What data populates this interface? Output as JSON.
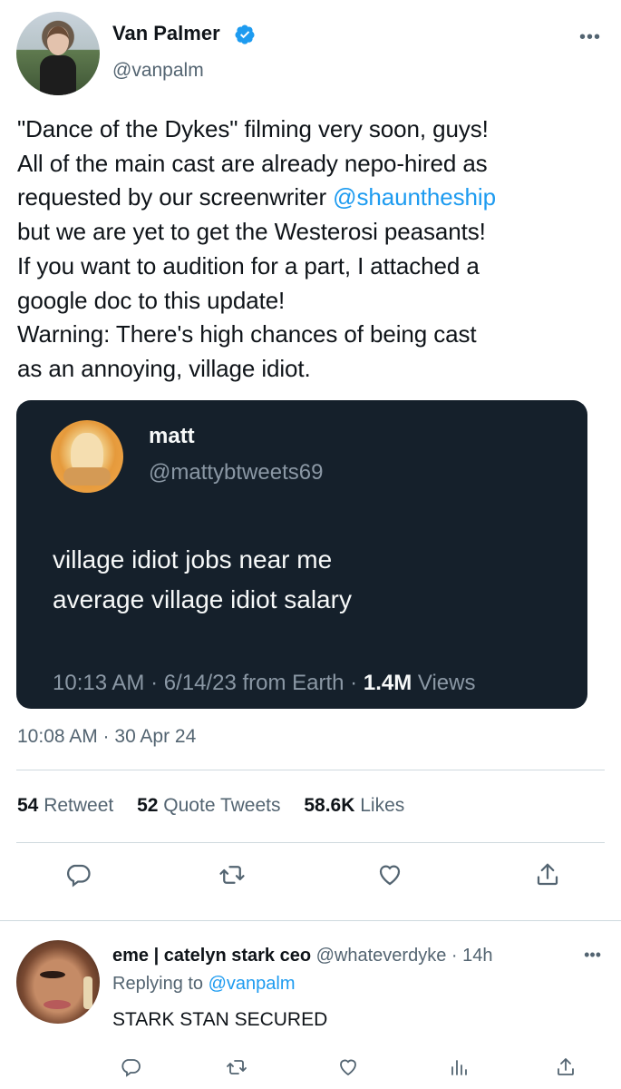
{
  "tweet": {
    "author_name": "Van Palmer",
    "author_handle": "@vanpalm",
    "more_icon": "more-dots-icon",
    "text_line1": "\"Dance of the Dykes\" filming very soon, guys!",
    "text_line2": "All of the main cast are already nepo-hired as",
    "text_line3_pre": "requested by our screenwriter ",
    "text_line3_mention": "@shauntheship",
    "text_line4": "but we are yet to get the Westerosi peasants!",
    "text_line5": "If you want to audition for a part, I attached a",
    "text_line6": "google doc to this update!",
    "text_line7": "Warning: There's high chances of being cast",
    "text_line8": "as an annoying, village idiot.",
    "timestamp": "10:08 AM · 30 Apr 24",
    "stats": {
      "retweets_count": "54",
      "retweets_label": "Retweet",
      "quotes_count": "52",
      "quotes_label": "Quote Tweets",
      "likes_count": "58.6K",
      "likes_label": "Likes"
    }
  },
  "embed": {
    "name": "matt",
    "handle": "@mattybtweets69",
    "text": "village idiot jobs near me\naverage village idiot salary",
    "meta_time": "10:13 AM · 6/14/23 from Earth · ",
    "meta_views_count": "1.4M",
    "meta_views_label": " Views"
  },
  "reply": {
    "name": "eme | catelyn stark ceo",
    "handle": "@whateverdyke",
    "time": " · 14h",
    "replying_label": "Replying to ",
    "replying_to": "@vanpalm",
    "text": "STARK STAN SECURED"
  },
  "colors": {
    "accent": "#1d9bf0",
    "text": "#0f1419",
    "muted": "#536471",
    "embed_bg": "#15202b"
  }
}
